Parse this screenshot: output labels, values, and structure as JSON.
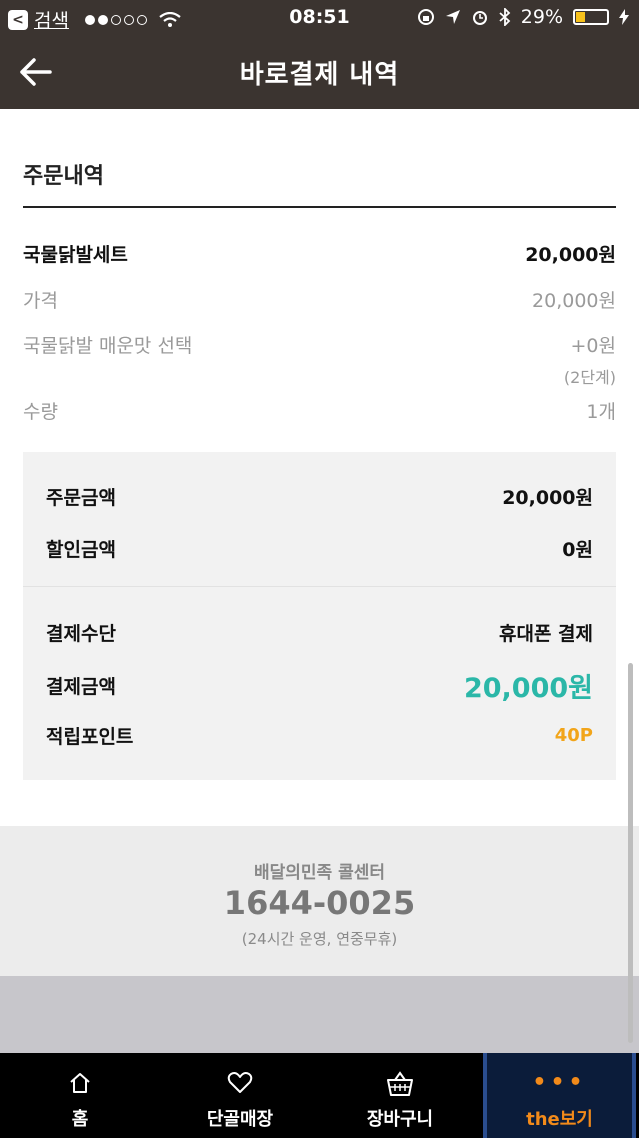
{
  "status_bar": {
    "back_app_label": "검색",
    "time": "08:51",
    "battery": "29%",
    "battery_level": 0.29
  },
  "header": {
    "title": "바로결제 내역"
  },
  "order": {
    "section_title": "주문내역",
    "item_name": "국물닭발세트",
    "item_total": "20,000원",
    "price_label": "가격",
    "price_value": "20,000원",
    "option_label": "국물닭발 매운맛 선택",
    "option_value": "+0원",
    "option_note": "(2단계)",
    "qty_label": "수량",
    "qty_value": "1개"
  },
  "summary": {
    "order_amount_label": "주문금액",
    "order_amount": "20,000원",
    "discount_label": "할인금액",
    "discount": "0원",
    "payment_method_label": "결제수단",
    "payment_method": "휴대폰 결제",
    "payment_amount_label": "결제금액",
    "payment_amount": "20,000원",
    "points_label": "적립포인트",
    "points": "40P"
  },
  "call_center": {
    "title": "배달의민족 콜센터",
    "number": "1644-0025",
    "note": "(24시간 운영, 연중무휴)"
  },
  "tabs": [
    {
      "label": "홈",
      "icon": "home-icon"
    },
    {
      "label": "단골매장",
      "icon": "heart-icon"
    },
    {
      "label": "장바구니",
      "icon": "basket-icon"
    },
    {
      "label": "the보기",
      "icon": "more-dots-icon"
    }
  ],
  "colors": {
    "header_bg": "#3b3430",
    "accent_teal": "#2bb7a8",
    "points_orange": "#f2a51a",
    "tab_more_orange": "#f28a1a"
  }
}
